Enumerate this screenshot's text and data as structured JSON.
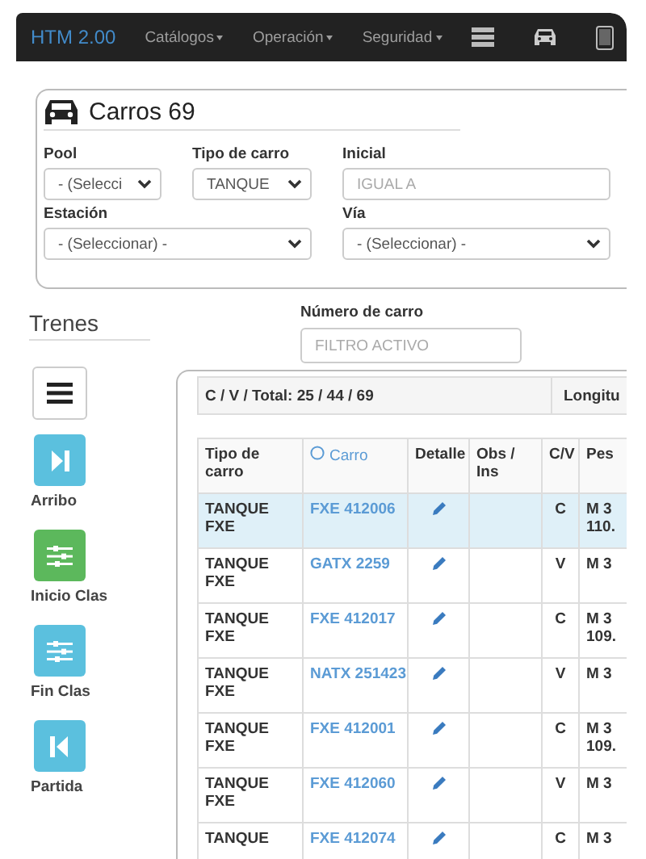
{
  "navbar": {
    "brand": "HTM 2.00",
    "menus": [
      {
        "label": "Catálogos"
      },
      {
        "label": "Operación"
      },
      {
        "label": "Seguridad"
      }
    ],
    "icons": [
      {
        "kind": "server"
      },
      {
        "kind": "car"
      },
      {
        "kind": "tablet"
      }
    ]
  },
  "filters": {
    "title": "Carros 69",
    "fields": [
      {
        "label": "Pool",
        "kind": "select",
        "value": "- (Selecci"
      },
      {
        "label": "Tipo de carro",
        "kind": "select",
        "value": "TANQUE"
      },
      {
        "label": "Inicial",
        "kind": "input",
        "placeholder": "IGUAL A"
      },
      {
        "label": "Estación",
        "kind": "select",
        "value": "- (Seleccionar) -"
      },
      {
        "label": "Vía",
        "kind": "select",
        "value": "- (Seleccionar) -"
      }
    ]
  },
  "sidebar": {
    "title": "Trenes",
    "buttons": [
      {
        "kind": "menu"
      },
      {
        "kind": "skip-end",
        "label": "Arribo",
        "color": "#5bc0de"
      },
      {
        "kind": "sliders",
        "label": "Inicio Clas",
        "color": "#5cb85c"
      },
      {
        "kind": "sliders",
        "label": "Fin Clas",
        "color": "#5bc0de"
      },
      {
        "kind": "skip-start",
        "label": "Partida",
        "color": "#5bc0de"
      }
    ]
  },
  "car_filter": {
    "label": "Número de carro",
    "placeholder": "FILTRO ACTIVO"
  },
  "summary": {
    "totals": "C / V / Total: 25 / 44 / 69",
    "column_2": "Longitu"
  },
  "table": {
    "columns": [
      "Tipo de carro",
      "Carro",
      "Detalle",
      "Obs / Ins",
      "C/V",
      "Pes"
    ],
    "rows": [
      {
        "tipo": "TANQUE FXE",
        "carro": "FXE 412006",
        "cv": "C",
        "peso": [
          "M 3",
          "110."
        ],
        "selected": true
      },
      {
        "tipo": "TANQUE FXE",
        "carro": "GATX 2259",
        "cv": "V",
        "peso": [
          "M 3"
        ],
        "selected": false
      },
      {
        "tipo": "TANQUE FXE",
        "carro": "FXE 412017",
        "cv": "C",
        "peso": [
          "M 3",
          "109."
        ],
        "selected": false
      },
      {
        "tipo": "TANQUE FXE",
        "carro": "NATX 251423",
        "cv": "V",
        "peso": [
          "M 3"
        ],
        "selected": false
      },
      {
        "tipo": "TANQUE FXE",
        "carro": "FXE 412001",
        "cv": "C",
        "peso": [
          "M 3",
          "109."
        ],
        "selected": false
      },
      {
        "tipo": "TANQUE FXE",
        "carro": "FXE 412060",
        "cv": "V",
        "peso": [
          "M 3"
        ],
        "selected": false
      },
      {
        "tipo": "TANQUE",
        "carro": "FXE 412074",
        "cv": "C",
        "peso": [
          "M 3"
        ],
        "selected": false
      }
    ]
  }
}
